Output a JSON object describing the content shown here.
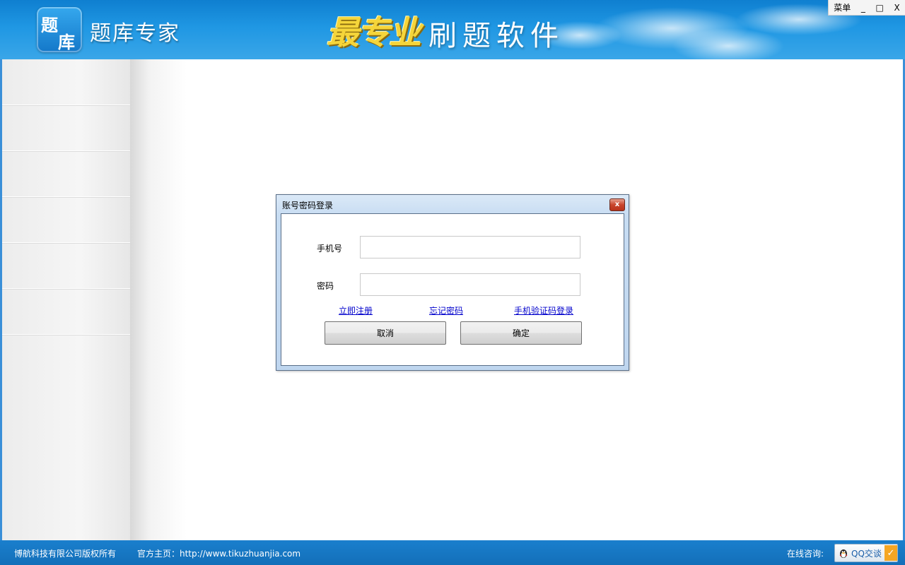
{
  "header": {
    "logo_chars": [
      "题",
      "库"
    ],
    "app_name": "题库专家",
    "slogan_main": "最专业",
    "slogan_sub": "刷题软件",
    "window_controls": {
      "menu": "菜单",
      "minimize": "_",
      "maximize": "□",
      "close": "X"
    }
  },
  "dialog": {
    "title": "账号密码登录",
    "close_glyph": "x",
    "phone_label": "手机号",
    "phone_value": "",
    "password_label": "密码",
    "password_value": "",
    "links": {
      "register": "立即注册",
      "forgot": "忘记密码",
      "sms_login": "手机验证码登录"
    },
    "cancel_label": "取消",
    "confirm_label": "确定"
  },
  "footer": {
    "copyright": "博航科技有限公司版权所有",
    "homepage": "官方主页：http://www.tikuzhuanjia.com",
    "consult_label": "在线咨询:",
    "qq_button": "QQ交谈"
  },
  "colors": {
    "header_blue": "#1f97e3",
    "footer_blue": "#136fb9",
    "link_blue": "#0000cc",
    "accent_gold": "#f5d53a"
  }
}
